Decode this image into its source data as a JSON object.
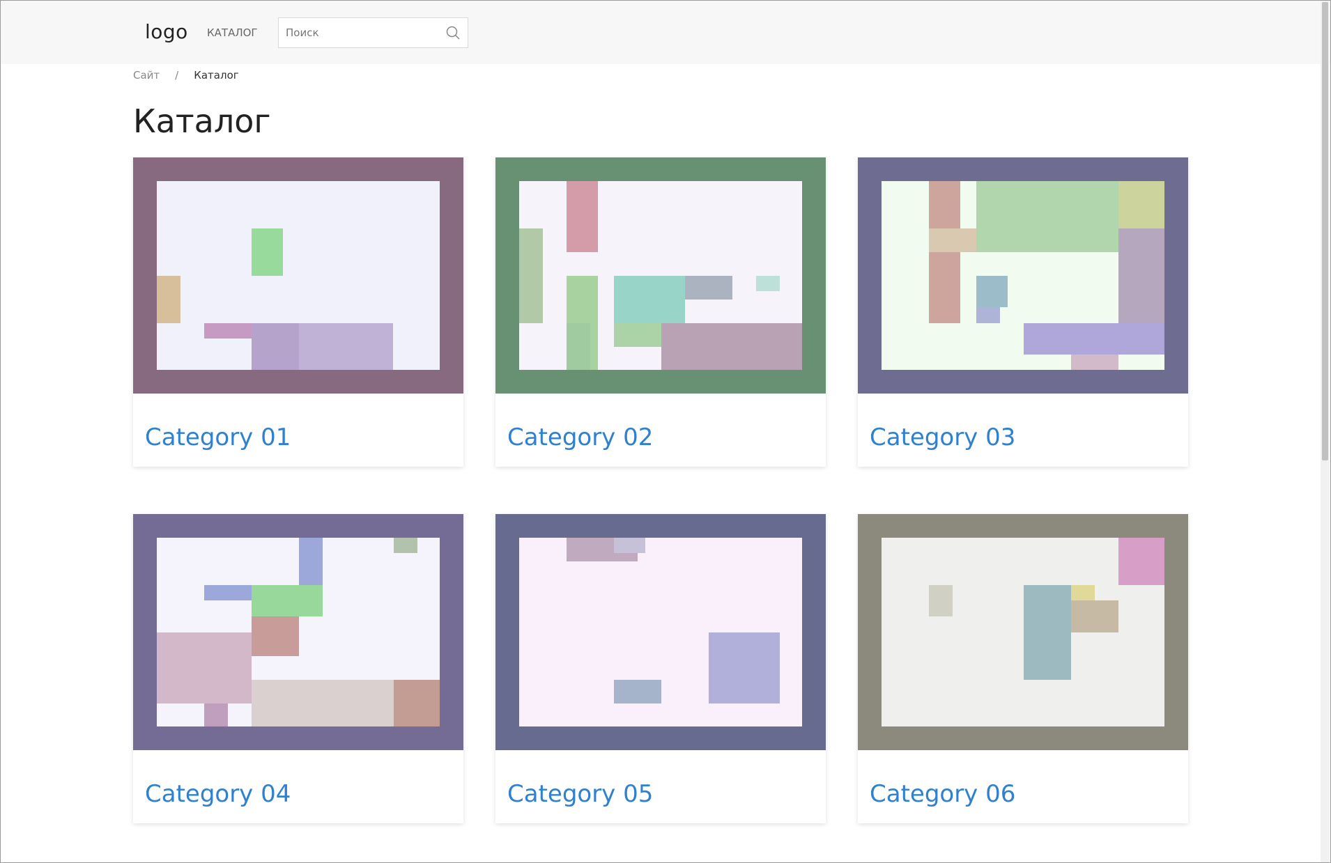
{
  "header": {
    "logo": "logo",
    "nav_catalog": "КАТАЛОГ",
    "search": {
      "placeholder": "Поиск",
      "value": ""
    }
  },
  "breadcrumb": {
    "site": "Сайт",
    "separator": "/",
    "current": "Каталог"
  },
  "page_title": "Каталог",
  "link_color": "#2f80d0",
  "categories": [
    {
      "title": "Category 01",
      "frame": "#876a80",
      "inner": "#f1f1fb"
    },
    {
      "title": "Category 02",
      "frame": "#689073",
      "inner": "#f6f4fa"
    },
    {
      "title": "Category 03",
      "frame": "#6e6d91",
      "inner": "#f2fbef"
    },
    {
      "title": "Category 04",
      "frame": "#756c95",
      "inner": "#f5f4fc"
    },
    {
      "title": "Category 05",
      "frame": "#676b8f",
      "inner": "#faf0fb"
    },
    {
      "title": "Category 06",
      "frame": "#8b8a7c",
      "inner": "#eff0ee"
    }
  ]
}
